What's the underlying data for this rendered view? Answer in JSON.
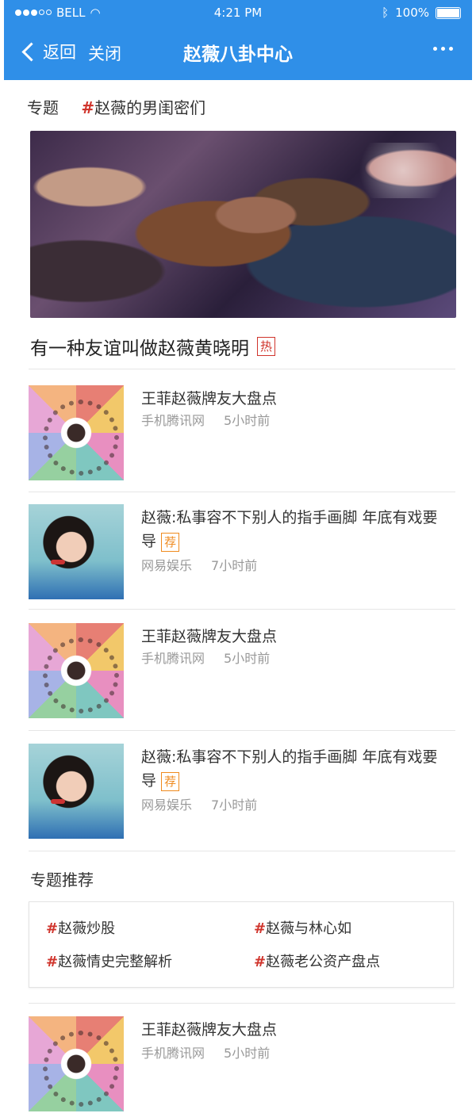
{
  "status_bar": {
    "carrier": "BELL",
    "time": "4:21 PM",
    "battery": "100%"
  },
  "nav": {
    "back_label": "返回",
    "close_label": "关闭",
    "title": "赵薇八卦中心"
  },
  "topic": {
    "label": "专题",
    "hash": "#",
    "tag": "赵薇的男闺密们"
  },
  "hero": {
    "title": "有一种友谊叫做赵薇黄晓明",
    "badge": "热"
  },
  "news": [
    {
      "title": "王菲赵薇牌友大盘点",
      "source": "手机腾讯网",
      "time": "5小时前",
      "thumb": "wheel"
    },
    {
      "title": "赵薇:私事容不下别人的指手画脚 年底有戏要导",
      "badge": "荐",
      "source": "网易娱乐",
      "time": "7小时前",
      "thumb": "portrait"
    },
    {
      "title": "王菲赵薇牌友大盘点",
      "source": "手机腾讯网",
      "time": "5小时前",
      "thumb": "wheel"
    },
    {
      "title": "赵薇:私事容不下别人的指手画脚 年底有戏要导",
      "badge": "荐",
      "source": "网易娱乐",
      "time": "7小时前",
      "thumb": "portrait"
    },
    {
      "title": "王菲赵薇牌友大盘点",
      "source": "手机腾讯网",
      "time": "5小时前",
      "thumb": "wheel"
    }
  ],
  "recommend": {
    "heading": "专题推荐",
    "hash": "#",
    "items": [
      "赵薇炒股",
      "赵薇与林心如",
      "赵薇情史完整解析",
      "赵薇老公资产盘点"
    ]
  },
  "colors": {
    "header_bg": "#2f8fe8",
    "hash": "#d0342c",
    "hot_badge": "#d0342c",
    "rec_badge": "#ef8a1e"
  }
}
